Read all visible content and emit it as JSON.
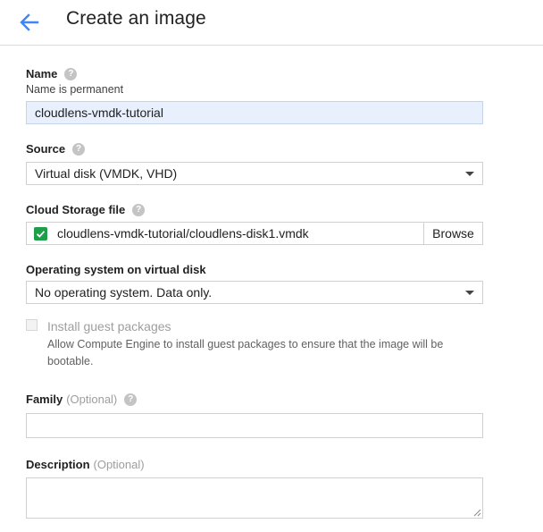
{
  "header": {
    "title": "Create an image",
    "back_icon": "arrow-left-icon"
  },
  "colors": {
    "accent": "#4285f4",
    "check_green": "#1e9e49",
    "name_field_bg": "#e8f0fe"
  },
  "name": {
    "label": "Name",
    "hint": "Name is permanent",
    "value": "cloudlens-vmdk-tutorial"
  },
  "source": {
    "label": "Source",
    "selected": "Virtual disk (VMDK, VHD)"
  },
  "cloud_storage": {
    "label": "Cloud Storage file",
    "value": "cloudlens-vmdk-tutorial/cloudlens-disk1.vmdk",
    "browse_label": "Browse"
  },
  "os": {
    "label": "Operating system on virtual disk",
    "selected": "No operating system. Data only."
  },
  "guest_packages": {
    "label": "Install guest packages",
    "description": "Allow Compute Engine to install guest packages to ensure that the image will be bootable.",
    "checked": false
  },
  "family": {
    "label": "Family",
    "optional": "(Optional)",
    "value": ""
  },
  "description": {
    "label": "Description",
    "optional": "(Optional)",
    "value": ""
  },
  "help_glyph": "?"
}
